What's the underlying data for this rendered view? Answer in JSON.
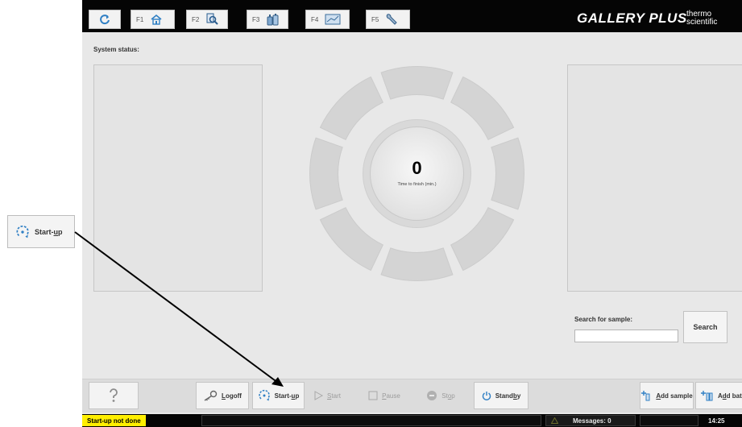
{
  "topbar": {
    "tabs": [
      {
        "key": "F1",
        "icon": "home-icon"
      },
      {
        "key": "F2",
        "icon": "magnifier-icon"
      },
      {
        "key": "F3",
        "icon": "reagent-bottles-icon"
      },
      {
        "key": "F4",
        "icon": "monitor-icon"
      },
      {
        "key": "F5",
        "icon": "wrench-icon"
      }
    ],
    "refresh_icon": "refresh-icon",
    "brand": "GALLERY PLUS",
    "brand_small": "thermo\nscientific"
  },
  "main": {
    "status_label": "System status:",
    "timer": {
      "value": "0",
      "label": "Time to finish (min.)"
    },
    "search": {
      "label": "Search for sample:",
      "input_value": "",
      "button": "Search"
    }
  },
  "toolbar": {
    "help": {
      "icon": "help-icon"
    },
    "logoff": {
      "pre": "",
      "u": "L",
      "post": "ogoff",
      "icon": "key-icon"
    },
    "startup": {
      "pre": "Start-",
      "u": "u",
      "post": "p",
      "icon": "startup-icon"
    },
    "start": {
      "pre": "",
      "u": "S",
      "post": "tart",
      "icon": "play-icon"
    },
    "pause": {
      "pre": "",
      "u": "P",
      "post": "ause",
      "icon": "pause-icon"
    },
    "stop": {
      "pre": "St",
      "u": "o",
      "post": "p",
      "icon": "stop-icon"
    },
    "standby": {
      "pre": "Stand",
      "u": "b",
      "post": "y",
      "icon": "power-icon"
    },
    "add_sample": {
      "pre": "",
      "u": "A",
      "post": "dd sample",
      "icon": "add-sample-icon"
    },
    "add_batch": {
      "pre": "A",
      "u": "d",
      "post": "d bat",
      "icon": "add-batch-icon"
    }
  },
  "statusbar": {
    "status_text": "Start-up not done",
    "status_color": "#ffef00",
    "messages": "Messages: 0",
    "warning_icon": "warning-icon",
    "time": "14:25"
  },
  "callout": {
    "pre": "Start-",
    "u": "u",
    "post": "p"
  }
}
